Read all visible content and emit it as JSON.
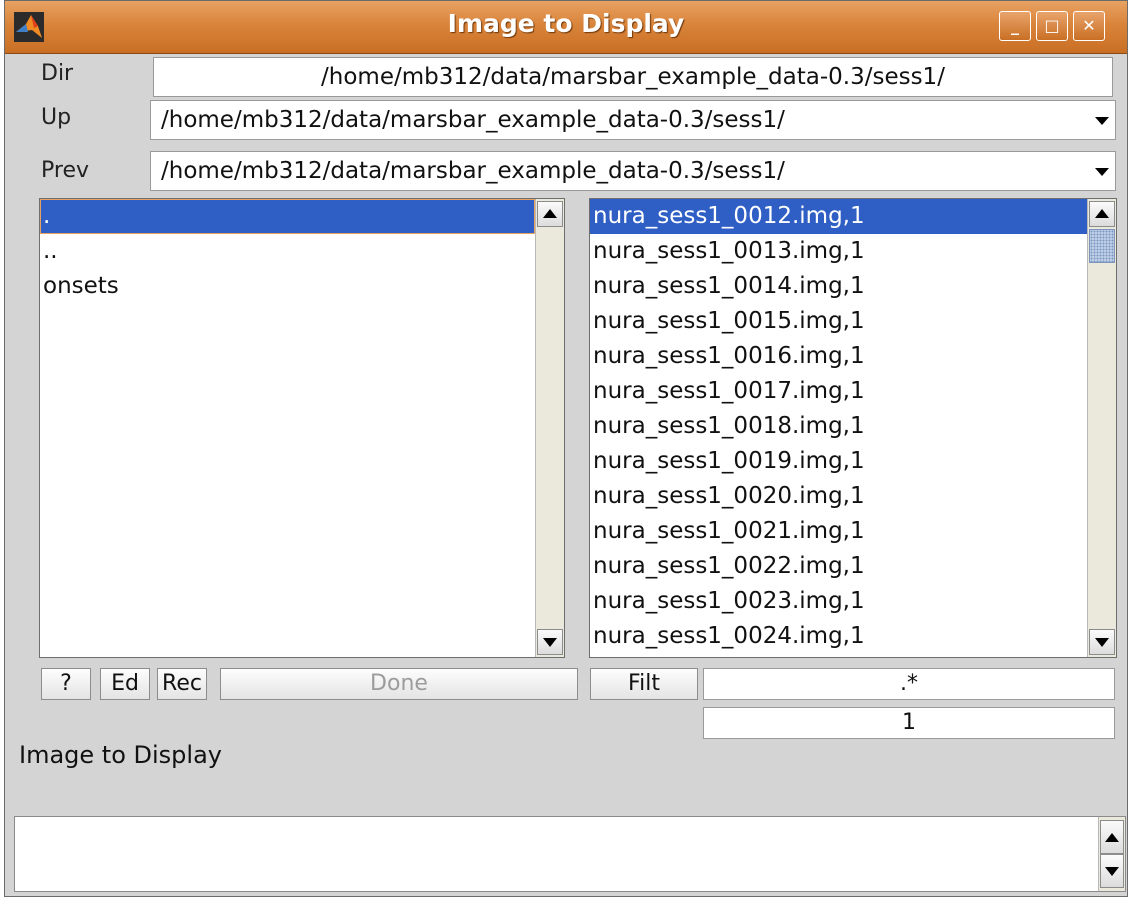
{
  "window": {
    "title": "Image to Display",
    "controls": {
      "minimize": "_",
      "maximize": "□",
      "close": "✕"
    }
  },
  "dir": {
    "label": "Dir",
    "value": "/home/mb312/data/marsbar_example_data-0.3/sess1/"
  },
  "up": {
    "label": "Up",
    "value": "/home/mb312/data/marsbar_example_data-0.3/sess1/"
  },
  "prev": {
    "label": "Prev",
    "value": "/home/mb312/data/marsbar_example_data-0.3/sess1/"
  },
  "dirs_list": {
    "items": [
      ".",
      "..",
      "onsets"
    ],
    "selected": 0
  },
  "files_list": {
    "items": [
      "nura_sess1_0012.img,1",
      "nura_sess1_0013.img,1",
      "nura_sess1_0014.img,1",
      "nura_sess1_0015.img,1",
      "nura_sess1_0016.img,1",
      "nura_sess1_0017.img,1",
      "nura_sess1_0018.img,1",
      "nura_sess1_0019.img,1",
      "nura_sess1_0020.img,1",
      "nura_sess1_0021.img,1",
      "nura_sess1_0022.img,1",
      "nura_sess1_0023.img,1",
      "nura_sess1_0024.img,1"
    ],
    "selected": 0
  },
  "buttons": {
    "help": "?",
    "ed": "Ed",
    "rec": "Rec",
    "done": "Done",
    "filt": "Filt"
  },
  "filter": {
    "value": ".*"
  },
  "frame": {
    "value": "1"
  },
  "prompt": "Image to Display",
  "colors": {
    "titlebar": "#d9843b",
    "selection": "#2f5fc4",
    "background": "#d4d4d4"
  }
}
